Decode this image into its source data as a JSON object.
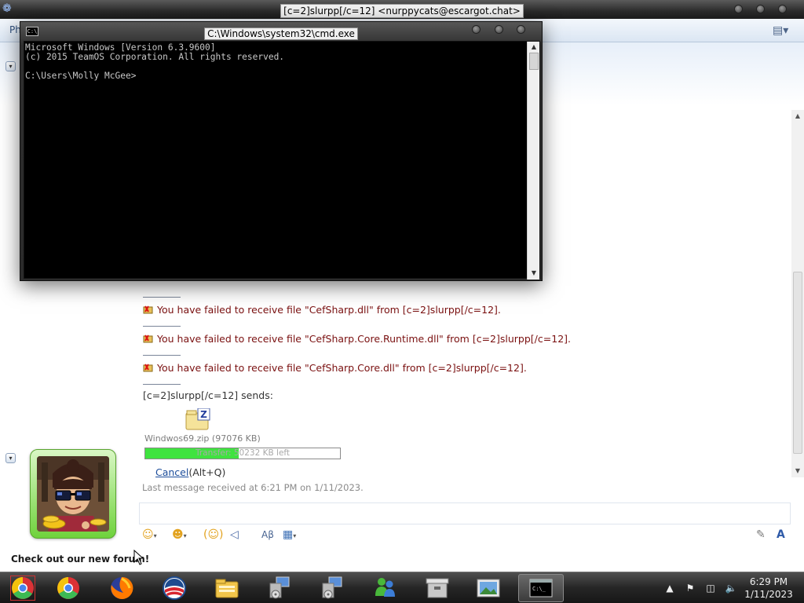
{
  "messenger": {
    "window_title": "[c=2]slurpp[/c=12] <nurppycats@escargot.chat>",
    "toolbar_label": "Ph",
    "failures": [
      {
        "text": "You have failed to receive file \"CefSharp.dll\" from [c=2]slurpp[/c=12]."
      },
      {
        "text": "You have failed to receive file \"CefSharp.Core.Runtime.dll\" from [c=2]slurpp[/c=12]."
      },
      {
        "text": "You have failed to receive file \"CefSharp.Core.dll\" from [c=2]slurpp[/c=12]."
      }
    ],
    "sends_text": "[c=2]slurpp[/c=12] sends:",
    "file_name": "Windwos69.zip (97076 KB)",
    "transfer_text": "Transfer: 50232 KB left",
    "transfer_progress": 0.48,
    "cancel_label": "Cancel",
    "cancel_shortcut": "(Alt+Q)",
    "last_message": "Last message received at 6:21 PM on 1/11/2023.",
    "forum_link": "Check out our new forum!"
  },
  "cmd": {
    "window_title": "C:\\Windows\\system32\\cmd.exe",
    "icon_label": "C:\\",
    "line1": "Microsoft Windows [Version 6.3.9600]",
    "line2": "(c) 2015 TeamOS Corporation. All rights reserved.",
    "line3": "",
    "line4": "C:\\Users\\Molly McGee>"
  },
  "taskbar": {
    "items": [
      "chrome-icon",
      "chrome-icon",
      "firefox-icon",
      "obama-logo-icon",
      "file-explorer-icon",
      "network-setup-icon",
      "network-setup-icon",
      "messenger-icon",
      "archive-icon",
      "image-viewer-icon",
      "cmd-icon"
    ],
    "clock_time": "6:29 PM",
    "clock_date": "1/11/2023"
  },
  "colors": {
    "fail_text": "#7a1010",
    "progress_fill": "#3fe33f",
    "link": "#1c4d9b"
  }
}
